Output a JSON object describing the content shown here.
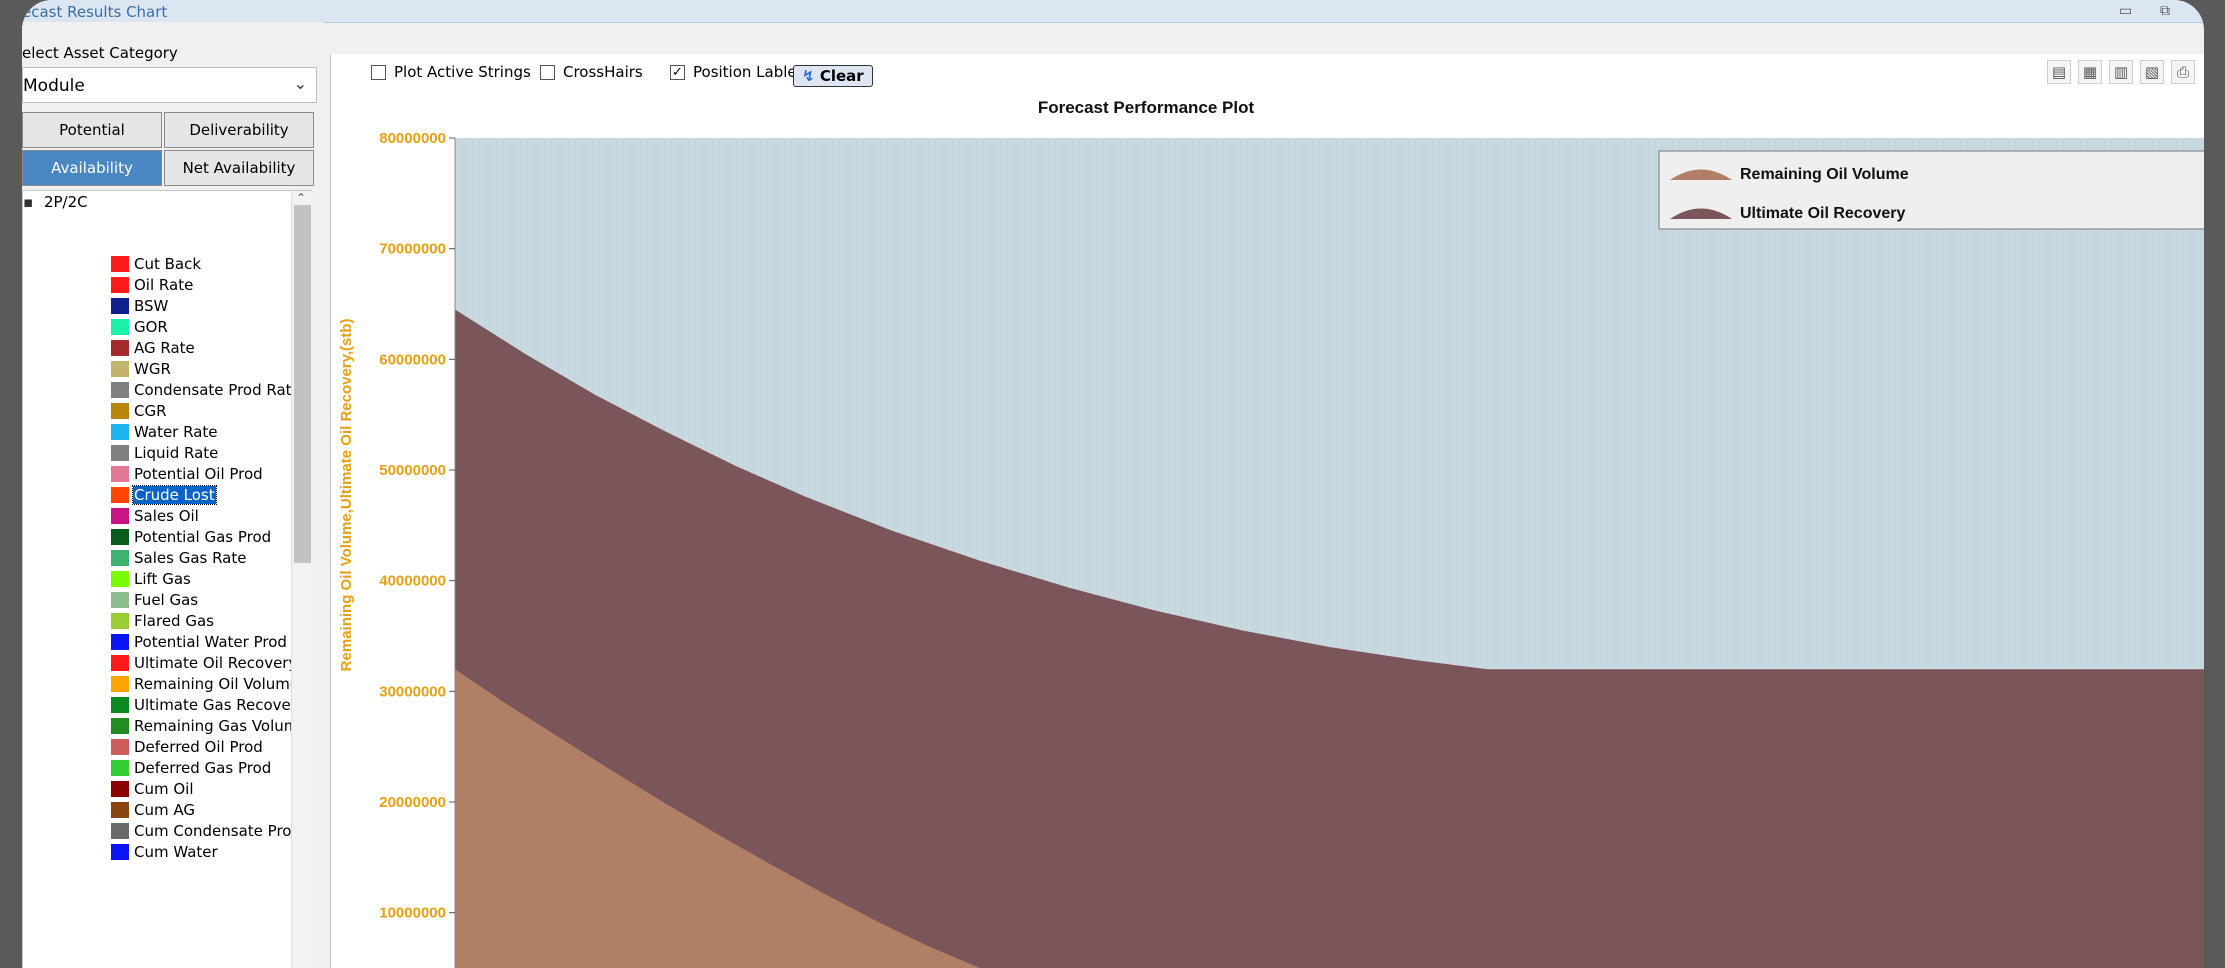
{
  "window": {
    "title": "ecast Results Chart",
    "minimize_glyph": "▭",
    "restore_glyph": "⧉"
  },
  "sidebar": {
    "category_label": "elect Asset Category",
    "category_value": "Module",
    "tabs": [
      {
        "label": "Potential",
        "active": false
      },
      {
        "label": "Deliverability",
        "active": false
      },
      {
        "label": "Availability",
        "active": true
      },
      {
        "label": "Net Availability",
        "active": false
      }
    ],
    "tree_root": "2P/2C",
    "items": [
      {
        "label": "Cut Back",
        "color": "#ff1a1a"
      },
      {
        "label": "Oil Rate",
        "color": "#ff1a1a"
      },
      {
        "label": "BSW",
        "color": "#10208c"
      },
      {
        "label": "GOR",
        "color": "#19f0a8"
      },
      {
        "label": "AG Rate",
        "color": "#a52a2a"
      },
      {
        "label": "WGR",
        "color": "#c2b46a"
      },
      {
        "label": "Condensate Prod Rate",
        "color": "#808080"
      },
      {
        "label": "CGR",
        "color": "#b8860b"
      },
      {
        "label": "Water Rate",
        "color": "#1eb4f0"
      },
      {
        "label": "Liquid Rate",
        "color": "#808080"
      },
      {
        "label": "Potential Oil Prod",
        "color": "#e07896"
      },
      {
        "label": "Crude Lost",
        "color": "#ff4500",
        "selected": true
      },
      {
        "label": "Sales Oil",
        "color": "#c71585"
      },
      {
        "label": "Potential Gas Prod",
        "color": "#0a5c1e"
      },
      {
        "label": "Sales Gas Rate",
        "color": "#3cb371"
      },
      {
        "label": "Lift Gas",
        "color": "#7cfc00"
      },
      {
        "label": "Fuel Gas",
        "color": "#8fbc8f"
      },
      {
        "label": "Flared Gas",
        "color": "#9acd32"
      },
      {
        "label": "Potential Water Prod",
        "color": "#0a14f0"
      },
      {
        "label": "Ultimate Oil Recovery",
        "color": "#ff1a1a"
      },
      {
        "label": "Remaining Oil Volume",
        "color": "#ffa500"
      },
      {
        "label": "Ultimate Gas Recovery",
        "color": "#0a8a1e"
      },
      {
        "label": "Remaining Gas Volume",
        "color": "#228b22"
      },
      {
        "label": "Deferred Oil Prod",
        "color": "#cd5c5c"
      },
      {
        "label": "Deferred Gas Prod",
        "color": "#32cd32"
      },
      {
        "label": "Cum Oil",
        "color": "#8b0000"
      },
      {
        "label": "Cum AG",
        "color": "#8b4513"
      },
      {
        "label": "Cum Condensate Prod",
        "color": "#696969"
      },
      {
        "label": "Cum Water",
        "color": "#0a14f0"
      }
    ]
  },
  "toolbar": {
    "plot_active_strings": {
      "label": "Plot Active Strings",
      "checked": false
    },
    "crosshairs": {
      "label": "CrossHairs",
      "checked": false
    },
    "position_labels": {
      "label": "Position Lables",
      "checked": true
    },
    "clear_label": "Clear",
    "icons": [
      "export-pdf-icon",
      "export-excel-icon",
      "export-word-icon",
      "export-image-icon",
      "print-icon"
    ]
  },
  "chart_data": {
    "type": "area",
    "title": "Forecast Performance Plot",
    "ylabel": "Remaining Oil Volume,Ultimate Oil Recovery,(stb)",
    "ylim": [
      5000000,
      80000000
    ],
    "yticks": [
      "80000000",
      "70000000",
      "60000000",
      "50000000",
      "40000000",
      "30000000",
      "20000000",
      "10000000"
    ],
    "ytick_values": [
      80000000,
      70000000,
      60000000,
      50000000,
      40000000,
      30000000,
      20000000,
      10000000
    ],
    "x_domain": [
      0,
      100
    ],
    "plot_background": "#c9d9e0",
    "axis_color": "#e6a010",
    "legend_position": "top-right",
    "series": [
      {
        "name": "Ultimate Oil Recovery",
        "color": "#7a555a",
        "x": [
          0,
          4,
          8,
          12,
          16,
          20,
          25,
          30,
          35,
          40,
          45,
          50,
          55,
          59,
          65,
          70,
          75,
          80,
          85,
          90,
          95,
          100
        ],
        "values": [
          64500000,
          60500000,
          56800000,
          53500000,
          50400000,
          47600000,
          44500000,
          41800000,
          39400000,
          37300000,
          35500000,
          34000000,
          32800000,
          32000000,
          32000000,
          32000000,
          32000000,
          32000000,
          32000000,
          32000000,
          32000000,
          32000000
        ]
      },
      {
        "name": "Remaining Oil Volume",
        "color": "#b07f65",
        "x": [
          0,
          3,
          6,
          9,
          12,
          15,
          18,
          21,
          24,
          27,
          30,
          31
        ],
        "values": [
          32000000,
          28800000,
          25800000,
          22800000,
          19900000,
          17100000,
          14400000,
          11800000,
          9300000,
          7000000,
          5000000,
          4300000
        ]
      }
    ]
  }
}
